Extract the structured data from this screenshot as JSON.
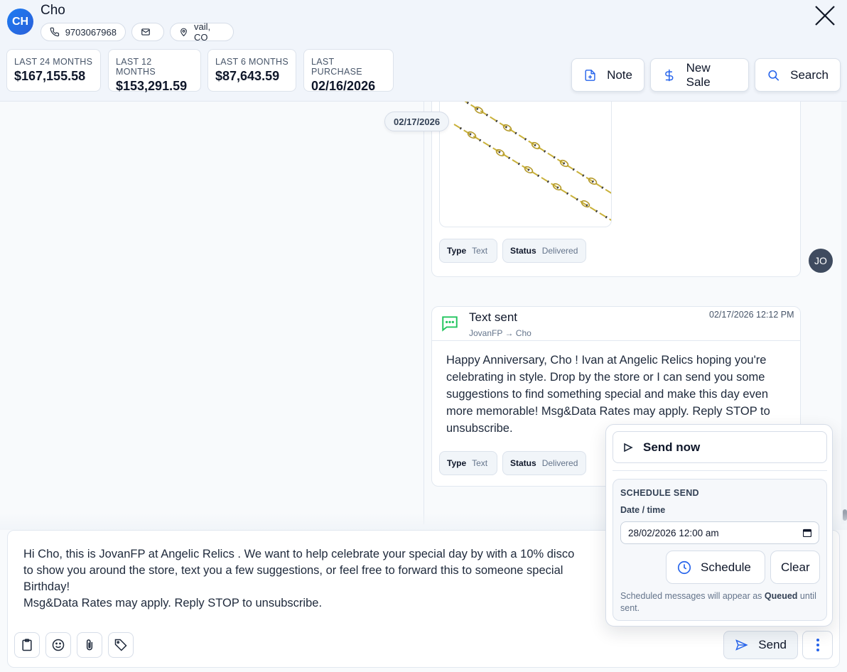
{
  "customer": {
    "initials": "CH",
    "name": "Cho",
    "phone": "9703067968",
    "location": "vail, CO"
  },
  "stats": [
    {
      "label": "LAST 24 MONTHS",
      "value": "$167,155.58"
    },
    {
      "label": "LAST 12 MONTHS",
      "value": "$153,291.59"
    },
    {
      "label": "LAST 6 MONTHS",
      "value": "$87,643.59"
    },
    {
      "label": "LAST PURCHASE",
      "value": "02/16/2026"
    }
  ],
  "actions": {
    "note": "Note",
    "new_sale": "New Sale",
    "search": "Search"
  },
  "thread": {
    "date_divider": "02/17/2026",
    "media_message": {
      "type_label": "Type",
      "type_value": "Text",
      "status_label": "Status",
      "status_value": "Delivered"
    },
    "sender_avatar": "JO",
    "text_message": {
      "title": "Text sent",
      "route": "JovanFP → Cho",
      "timestamp": "02/17/2026 12:12 PM",
      "body": "Happy Anniversary, Cho ! Ivan at Angelic Relics hoping you're celebrating in style. Drop by the store or I can send you some suggestions to find something special and make this day even more memorable! Msg&Data Rates may apply. Reply STOP to unsubscribe.",
      "type_label": "Type",
      "type_value": "Text",
      "status_label": "Status",
      "status_value": "Delivered"
    }
  },
  "composer": {
    "text": "Hi Cho, this is JovanFP at Angelic Relics . We want to help celebrate your special day by with a 10% disco\nto show you around the store, text you a few suggestions, or feel free to forward this to someone special\nBirthday!\nMsg&Data Rates may apply. Reply STOP to unsubscribe.",
    "send_label": "Send"
  },
  "send_menu": {
    "send_now": "Send now",
    "schedule_title": "SCHEDULE SEND",
    "date_label": "Date / time",
    "date_value": "28/02/2026 12:00 am",
    "schedule_btn": "Schedule",
    "clear_btn": "Clear",
    "note_prefix": "Scheduled messages will appear as ",
    "note_bold": "Queued",
    "note_suffix": " until sent."
  },
  "colors": {
    "accent": "#2563eb",
    "avatar": "#1d7cf2",
    "message_icon": "#22c55e"
  }
}
